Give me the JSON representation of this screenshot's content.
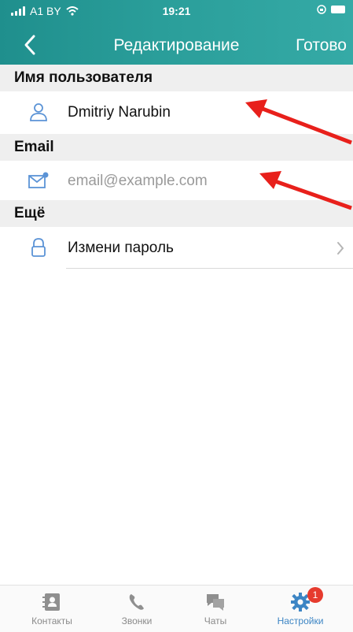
{
  "status_bar": {
    "carrier": "A1 BY",
    "time": "19:21"
  },
  "navbar": {
    "title": "Редактирование",
    "done_label": "Готово",
    "back_icon": "chevron-left-icon"
  },
  "sections": {
    "username": {
      "header": "Имя пользователя",
      "value": "Dmitriy Narubin",
      "icon": "user-icon"
    },
    "email": {
      "header": "Email",
      "value": "",
      "placeholder": "email@example.com",
      "icon": "mail-icon"
    },
    "more": {
      "header": "Ещё",
      "change_password_label": "Измени пароль",
      "icon": "lock-icon"
    }
  },
  "tabbar": {
    "tabs": [
      {
        "label": "Контакты",
        "icon": "contacts-icon",
        "active": false
      },
      {
        "label": "Звонки",
        "icon": "phone-icon",
        "active": false
      },
      {
        "label": "Чаты",
        "icon": "chat-icon",
        "active": false
      },
      {
        "label": "Настройки",
        "icon": "gear-icon",
        "active": true,
        "badge": "1"
      }
    ]
  },
  "colors": {
    "header_gradient_start": "#1f8f8d",
    "header_gradient_end": "#35aaa6",
    "accent_blue": "#3c85c4",
    "badge_red": "#e63b2e",
    "annotation_arrow": "#e8201b"
  }
}
